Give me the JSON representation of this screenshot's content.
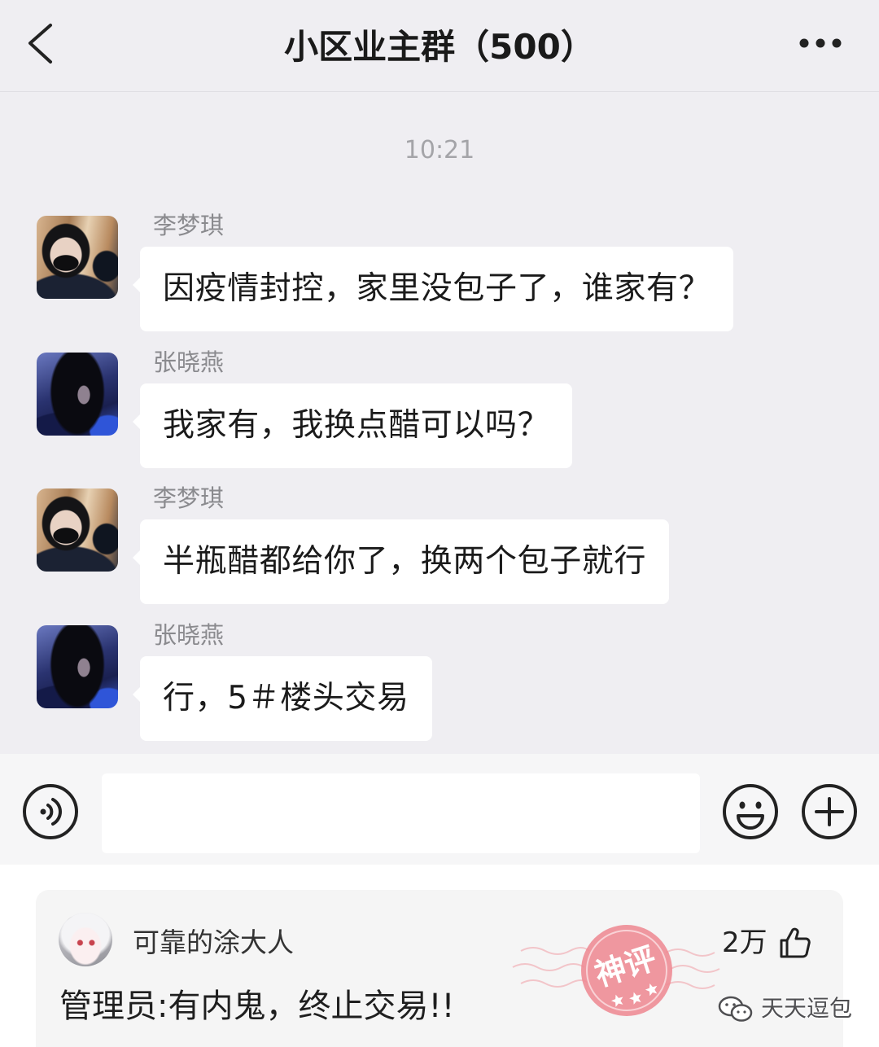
{
  "header": {
    "title": "小区业主群（500）",
    "back_icon": "chevron-left-icon",
    "more_icon": "more-dots-icon"
  },
  "chat": {
    "timestamp": "10:21",
    "messages": [
      {
        "sender": "李梦琪",
        "text": "因疫情封控，家里没包子了，谁家有？"
      },
      {
        "sender": "张晓燕",
        "text": "我家有，我换点醋可以吗？"
      },
      {
        "sender": "李梦琪",
        "text": "半瓶醋都给你了，换两个包子就行"
      },
      {
        "sender": "张晓燕",
        "text": "行，5＃楼头交易"
      }
    ]
  },
  "input_bar": {
    "voice_icon": "voice-icon",
    "value": "",
    "emoji_icon": "emoji-icon",
    "plus_icon": "plus-icon"
  },
  "comment": {
    "author": "可靠的涂大人",
    "likes": "2万",
    "like_icon": "thumbs-up-icon",
    "text": "管理员:有内鬼，终止交易!!",
    "badge": "神评"
  },
  "watermark": {
    "icon": "wechat-icon",
    "text": "天天逗包"
  },
  "colors": {
    "chat_background": "#efeef2",
    "bubble": "#ffffff",
    "text_primary": "#1b1b1b",
    "text_secondary": "#8a8a8e",
    "badge": "#ee8a93"
  }
}
